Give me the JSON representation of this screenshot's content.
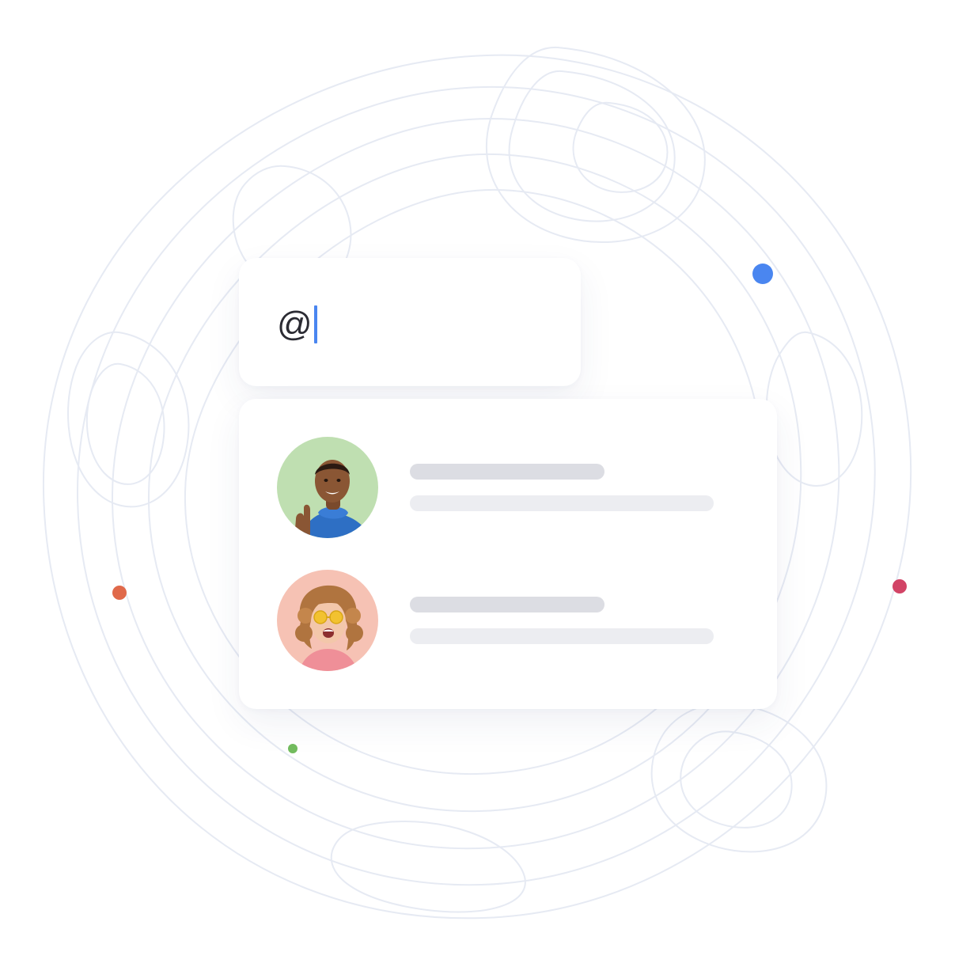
{
  "mention_input": {
    "typed_text": "@",
    "caret_color": "#4a86f0"
  },
  "suggestions": [
    {
      "avatar": "man-thumbs-up-avatar",
      "avatar_background": "#bfdfb1"
    },
    {
      "avatar": "woman-yellow-glasses-avatar",
      "avatar_background": "#f6c2b4"
    }
  ],
  "decor": {
    "dot_colors": {
      "blue": "#4a86f0",
      "orange": "#e0694a",
      "red": "#d24466",
      "green": "#72bb5e"
    },
    "contour_color": "#e6eaf3"
  }
}
